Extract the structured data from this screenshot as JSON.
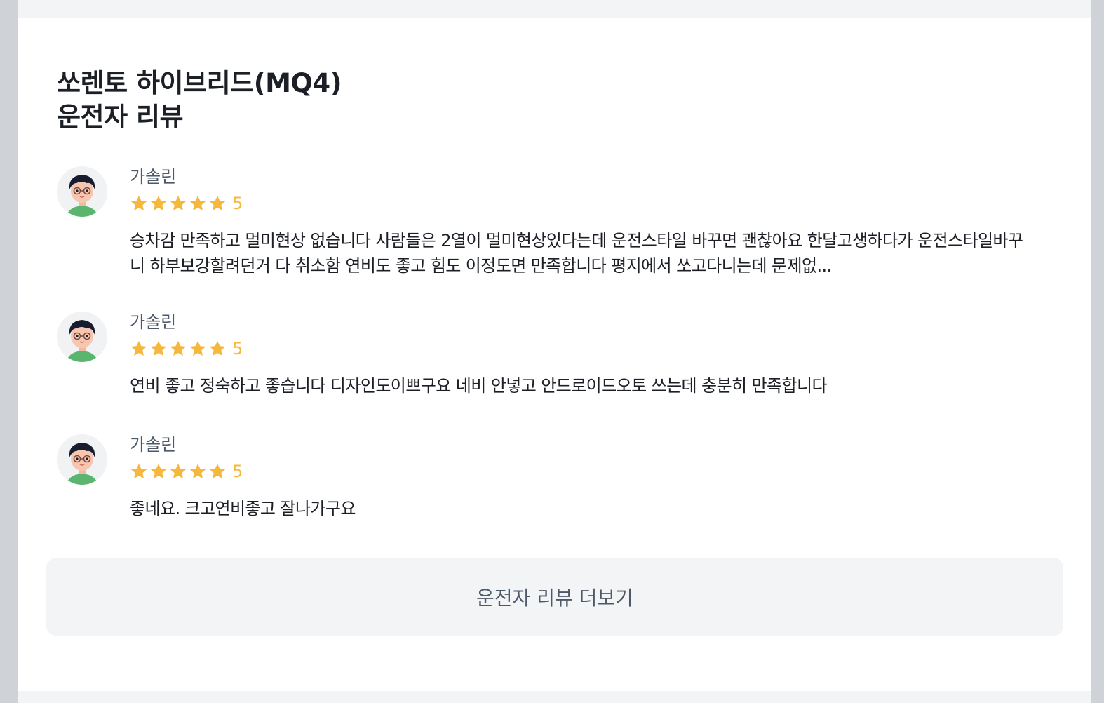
{
  "section": {
    "title_line1": "쏘렌토 하이브리드(MQ4)",
    "title_line2": "운전자 리뷰"
  },
  "reviews": [
    {
      "fuel": "가솔린",
      "rating": 5,
      "score": "5",
      "text": "승차감 만족하고 멀미현상 없습니다 사람들은 2열이 멀미현상있다는데 운전스타일 바꾸면 괜찮아요 한달고생하다가 운전스타일바꾸니 하부보강할려던거 다 취소함 연비도 좋고 힘도 이정도면 만족합니다 평지에서 쏘고다니는데 문제없..."
    },
    {
      "fuel": "가솔린",
      "rating": 5,
      "score": "5",
      "text": "연비 좋고 정숙하고 좋습니다 디자인도이쁘구요 네비 안넣고 안드로이드오토 쓰는데 충분히 만족합니다"
    },
    {
      "fuel": "가솔린",
      "rating": 5,
      "score": "5",
      "text": "좋네요. 크고연비좋고 잘나가구요"
    }
  ],
  "more_button": {
    "label": "운전자 리뷰 더보기"
  },
  "colors": {
    "star": "#f5b83d",
    "card_bg": "#ffffff",
    "page_bg": "#f2f4f6",
    "text": "#1c2026",
    "muted": "#4e5968"
  },
  "icons": {
    "avatar": "user-avatar-icon",
    "star": "star-icon"
  }
}
